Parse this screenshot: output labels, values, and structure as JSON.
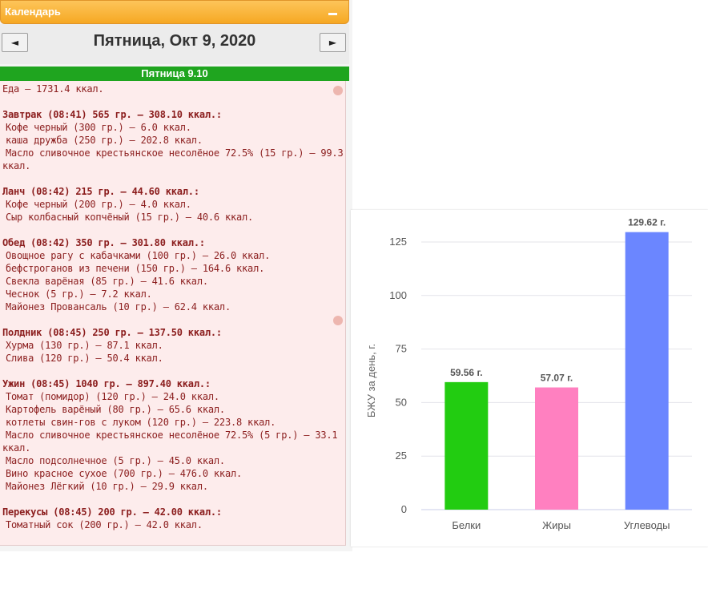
{
  "calendar": {
    "title": "Календарь",
    "date_title": "Пятница, Окт 9, 2020",
    "prev_label": "◄",
    "next_label": "►",
    "day_header": "Пятница 9.10"
  },
  "food_log": {
    "total": "Еда — 1731.4 ккал.",
    "lines": [
      {
        "text": "Завтрак (08:41) 565 гр. — 308.10 ккал.:",
        "bold": true
      },
      {
        "text": "Кофе черный (300 гр.) — 6.0 ккал.",
        "indent": true
      },
      {
        "text": "каша дружба (250 гр.) — 202.8 ккал.",
        "indent": true
      },
      {
        "text": "Масло сливочное крестьянское несолёное 72.5% (15 гр.) — 99.3",
        "indent": true
      },
      {
        "text": "ккал.",
        "indent": false
      },
      {
        "text": "Ланч (08:42) 215 гр. — 44.60 ккал.:",
        "bold": true
      },
      {
        "text": "Кофе черный (200 гр.) — 4.0 ккал.",
        "indent": true
      },
      {
        "text": "Сыр колбасный копчёный (15 гр.) — 40.6 ккал.",
        "indent": true
      },
      {
        "text": "Обед (08:42) 350 гр. — 301.80 ккал.:",
        "bold": true
      },
      {
        "text": "Овощное рагу с кабачками (100 гр.) — 26.0 ккал.",
        "indent": true
      },
      {
        "text": "бефстроганов из печени (150 гр.) — 164.6 ккал.",
        "indent": true
      },
      {
        "text": "Свекла варёная (85 гр.) — 41.6 ккал.",
        "indent": true
      },
      {
        "text": "Чеснок (5 гр.) — 7.2 ккал.",
        "indent": true
      },
      {
        "text": "Майонез Провансаль (10 гр.) — 62.4 ккал.",
        "indent": true
      },
      {
        "text": "Полдник (08:45) 250 гр. — 137.50 ккал.:",
        "bold": true
      },
      {
        "text": "Хурма (130 гр.) — 87.1 ккал.",
        "indent": true
      },
      {
        "text": "Слива (120 гр.) — 50.4 ккал.",
        "indent": true
      },
      {
        "text": "Ужин (08:45) 1040 гр. — 897.40 ккал.:",
        "bold": true
      },
      {
        "text": "Томат (помидор) (120 гр.) — 24.0 ккал.",
        "indent": true
      },
      {
        "text": "Картофель варёный (80 гр.) — 65.6 ккал.",
        "indent": true
      },
      {
        "text": "котлеты свин-гов с луком (120 гр.) — 223.8 ккал.",
        "indent": true
      },
      {
        "text": "Масло сливочное крестьянское несолёное 72.5% (5 гр.) — 33.1",
        "indent": true
      },
      {
        "text": "ккал.",
        "indent": false
      },
      {
        "text": "Масло подсолнечное (5 гр.) — 45.0 ккал.",
        "indent": true
      },
      {
        "text": "Вино красное сухое (700 гр.) — 476.0 ккал.",
        "indent": true
      },
      {
        "text": "Майонез Лёгкий (10 гр.) — 29.9 ккал.",
        "indent": true
      },
      {
        "text": "Перекусы (08:45) 200 гр. — 42.00 ккал.:",
        "bold": true
      },
      {
        "text": "Томатный сок (200 гр.) — 42.0 ккал.",
        "indent": true
      }
    ]
  },
  "chart_data": {
    "type": "bar",
    "categories": [
      "Белки",
      "Жиры",
      "Углеводы"
    ],
    "values": [
      59.56,
      57.07,
      129.62
    ],
    "value_labels": [
      "59.56 г.",
      "57.07 г.",
      "129.62 г."
    ],
    "colors": [
      "#22cc11",
      "#ff80c0",
      "#6b86ff"
    ],
    "ylabel": "БЖУ за день, г.",
    "yticks": [
      0,
      25,
      50,
      75,
      100,
      125
    ],
    "ylim": [
      0,
      125
    ],
    "grid": true
  }
}
